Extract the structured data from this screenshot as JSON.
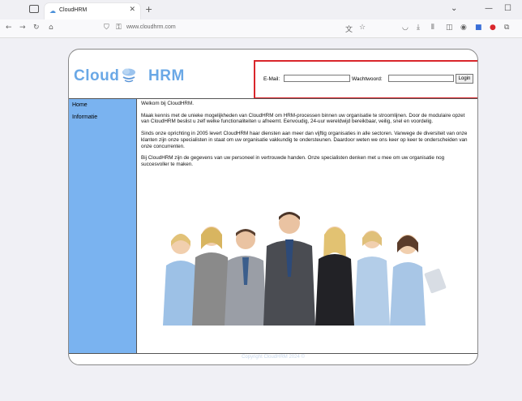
{
  "browser": {
    "tab_title": "CloudHRM",
    "url": "www.cloudhrm.com"
  },
  "site": {
    "logo_left": "Cloud",
    "logo_right": "HRM",
    "login": {
      "email_label": "E-Mail:",
      "email_value": "",
      "password_label": "Wachtwoord:",
      "password_value": "",
      "button_label": "Login"
    },
    "menu": [
      {
        "label": "Home"
      },
      {
        "label": "Informatie"
      }
    ],
    "content": {
      "welcome": "Welkom bij CloudHRM.",
      "p1": "Maak kennis met de unieke mogelijkheden van CloudHRM om HRM-processen binnen uw organisatie te stroomlijnen. Door de modulaire opzet van CloudHRM beslist u zelf welke functionaliteiten u afneemt. Eenvoudig, 24-uur wereldwijd bereikbaar, veilig, snel en voordelig.",
      "p2": "Sinds onze oprichting in 2005 levert CloudHRM haar diensten aan meer dan vijftig organisaties in alle sectoren. Vanwege de diversiteit van onze klanten zijn onze specialisten in staat om uw organisatie vakkundig te ondersteunen. Daardoor weten we ons keer op keer te onderscheiden van onze concurrenten.",
      "p3": "Bij CloudHRM zijn de gegevens van uw personeel in vertrouwde handen. Onze specialisten denken met u mee om uw organisatie nog succesvoller te maken."
    },
    "footer": "Copyright CloudHRM 2024 ©"
  },
  "colors": {
    "sidebar": "#7ab3f0",
    "logo": "#6aa8e6",
    "highlight": "#d9262b"
  }
}
